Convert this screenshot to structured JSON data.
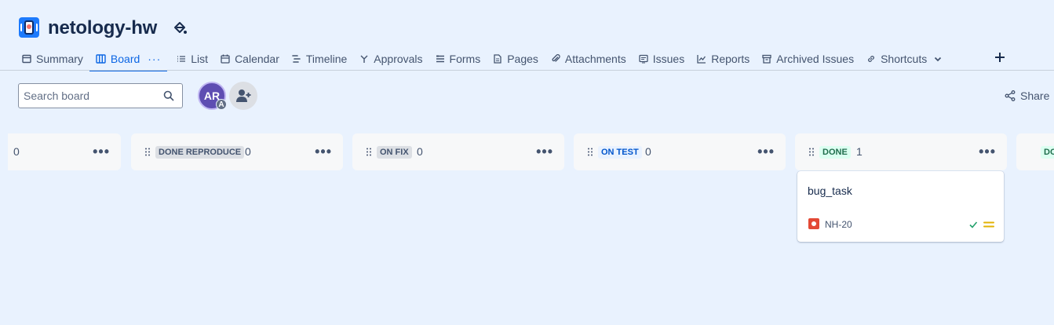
{
  "project": {
    "name": "netology-hw",
    "avatar_icon": "phone-app-icon",
    "theme_icon": "paint-bucket-icon"
  },
  "nav": {
    "tabs": [
      {
        "label": "Summary",
        "icon": "summary-icon"
      },
      {
        "label": "Board",
        "icon": "board-icon",
        "active": true
      },
      {
        "label": "List",
        "icon": "list-icon"
      },
      {
        "label": "Calendar",
        "icon": "calendar-icon"
      },
      {
        "label": "Timeline",
        "icon": "timeline-icon"
      },
      {
        "label": "Approvals",
        "icon": "approvals-icon"
      },
      {
        "label": "Forms",
        "icon": "forms-icon"
      },
      {
        "label": "Pages",
        "icon": "pages-icon"
      },
      {
        "label": "Attachments",
        "icon": "attachment-icon"
      },
      {
        "label": "Issues",
        "icon": "issues-icon"
      },
      {
        "label": "Reports",
        "icon": "reports-icon"
      },
      {
        "label": "Archived Issues",
        "icon": "archive-icon"
      },
      {
        "label": "Shortcuts",
        "icon": "link-icon"
      }
    ],
    "more_label": "···"
  },
  "toolbar": {
    "search_placeholder": "Search board",
    "avatar_initials": "AR",
    "avatar_badge": "A",
    "share_label": "Share"
  },
  "columns": [
    {
      "name": "",
      "count": "0",
      "style": "grey"
    },
    {
      "name": "DONE REPRODUCE",
      "count": "0",
      "style": "grey"
    },
    {
      "name": "ON FIX",
      "count": "0",
      "style": "grey"
    },
    {
      "name": "ON TEST",
      "count": "0",
      "style": "blue"
    },
    {
      "name": "DONE",
      "count": "1",
      "style": "green"
    },
    {
      "name": "DO",
      "count": "",
      "style": "green"
    }
  ],
  "card": {
    "title": "bug_task",
    "key": "NH-20",
    "issue_type_icon": "bug-icon",
    "status_icon": "check-icon",
    "priority_icon": "priority-medium-icon"
  },
  "colors": {
    "accent": "#0c66e4",
    "background": "#e9f2fe",
    "bug": "#e34935",
    "done_green": "#22a06b",
    "priority_medium": "#e2b203"
  }
}
